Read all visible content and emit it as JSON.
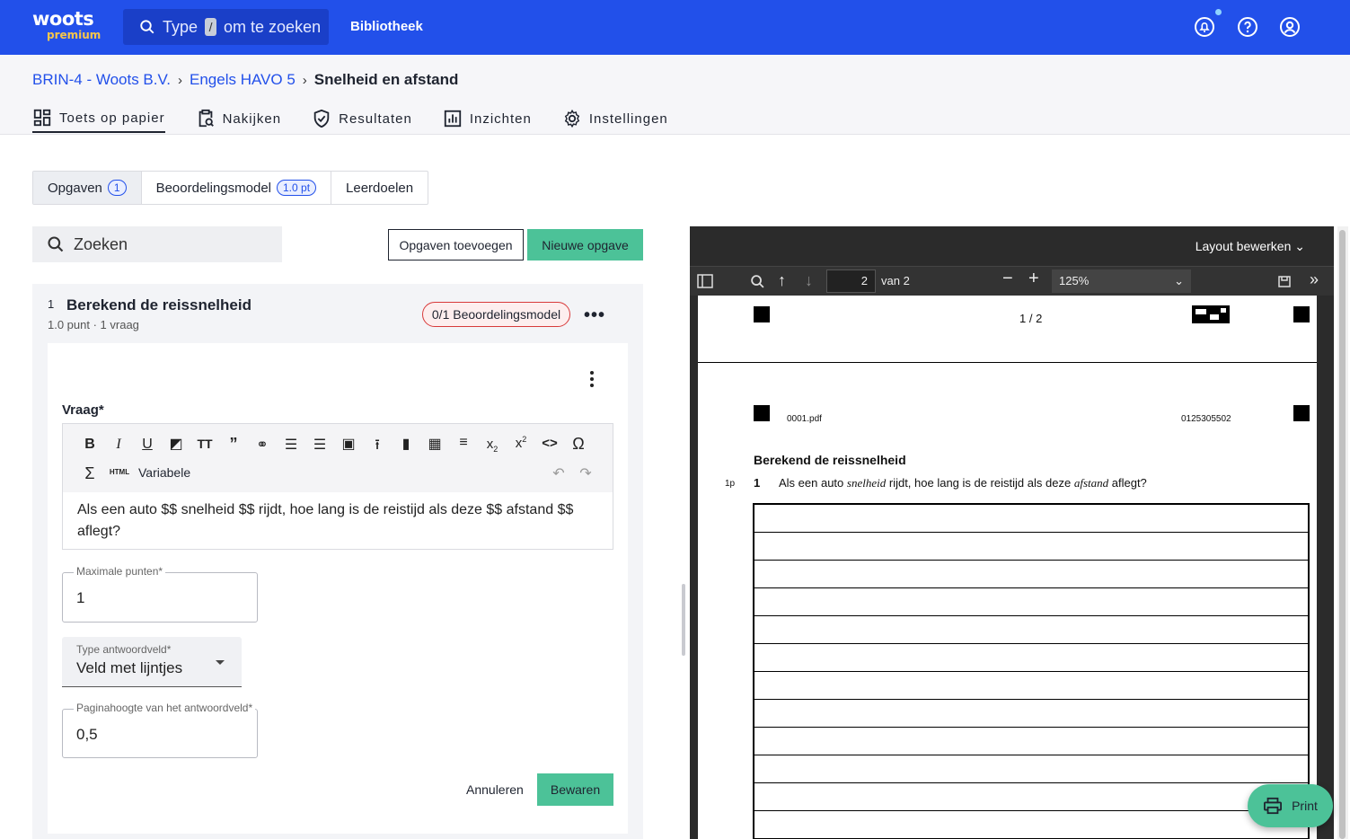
{
  "header": {
    "logo_main": "woots",
    "logo_sub": "premium",
    "search_prefix": "Type",
    "search_key": "/",
    "search_suffix": "om te zoeken",
    "library_label": "Bibliotheek"
  },
  "breadcrumb": {
    "items": [
      "BRIN-4 - Woots B.V.",
      "Engels HAVO 5"
    ],
    "current": "Snelheid en afstand",
    "separator": "›"
  },
  "nav_tabs": [
    {
      "label": "Toets op papier",
      "icon": "layout-icon",
      "active": true
    },
    {
      "label": "Nakijken",
      "icon": "clipboard-search-icon",
      "active": false
    },
    {
      "label": "Resultaten",
      "icon": "shield-check-icon",
      "active": false
    },
    {
      "label": "Inzichten",
      "icon": "bar-chart-icon",
      "active": false
    },
    {
      "label": "Instellingen",
      "icon": "gear-icon",
      "active": false
    }
  ],
  "segment_tabs": [
    {
      "label": "Opgaven",
      "badge": "1",
      "active": true
    },
    {
      "label": "Beoordelingsmodel",
      "badge": "1.0 pt",
      "active": false
    },
    {
      "label": "Leerdoelen",
      "badge": "",
      "active": false
    }
  ],
  "search": {
    "placeholder": "Zoeken"
  },
  "buttons": {
    "add_questions": "Opgaven toevoegen",
    "new_question": "Nieuwe opgave",
    "cancel": "Annuleren",
    "save": "Bewaren",
    "print": "Print"
  },
  "question": {
    "number": "1",
    "title": "Berekend de reissnelheid",
    "meta": "1.0 punt · 1 vraag",
    "rubric_status": "0/1 Beoordelingsmodel",
    "more": "•••",
    "vraag_label": "Vraag*",
    "editor_variable_label": "Variabele",
    "editor_html_label": "HTML",
    "editor_text": "Als een auto $$ snelheid $$ rijdt, hoe lang is de reistijd als deze $$ afstand $$ aflegt?",
    "max_points_label": "Maximale punten*",
    "max_points_value": "1",
    "answer_type_label": "Type antwoordveld*",
    "answer_type_value": "Veld met lijntjes",
    "page_height_label": "Paginahoogte van het antwoordveld*",
    "page_height_value": "0,5"
  },
  "pdf": {
    "layout_edit": "Layout bewerken",
    "page_current": "2",
    "page_total_label": "van 2",
    "zoom": "125%",
    "page_counter": "1 / 2",
    "filename": "0001.pdf",
    "code": "0125305502",
    "heading": "Berekend de reissnelheid",
    "points_label": "1p",
    "q_number": "1",
    "q_text_1": "Als een auto",
    "q_var_1": "snelheid",
    "q_text_2": "rijdt, hoe lang is de reistijd als deze",
    "q_var_2": "afstand",
    "q_text_3": "aflegt?",
    "answer_lines": 12
  },
  "colors": {
    "brand_blue": "#2250ea",
    "accent_green": "#4cc298",
    "alert_red": "#d83a3a",
    "logo_yellow": "#f6c64b"
  }
}
